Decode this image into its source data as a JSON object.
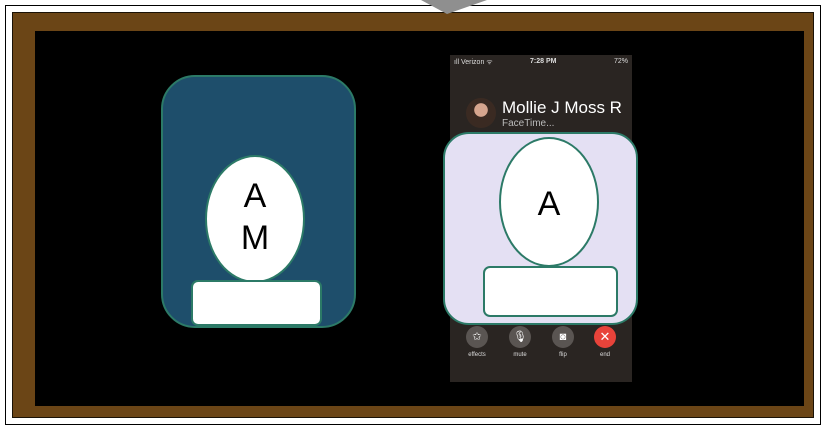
{
  "left_card": {
    "initials": [
      "A",
      "M"
    ]
  },
  "phone": {
    "status": {
      "carrier": "ıll Verizon ᯤ",
      "time": "7:28 PM",
      "battery": "72%"
    },
    "caller_name": "Mollie J Moss R",
    "caller_subtitle": "FaceTime...",
    "controls": [
      {
        "label": "effects",
        "icon": "star-icon",
        "glyph": "✩"
      },
      {
        "label": "mute",
        "icon": "mic-icon",
        "glyph": "🎙"
      },
      {
        "label": "flip",
        "icon": "camera-icon",
        "glyph": "◙"
      },
      {
        "label": "end",
        "icon": "close-icon",
        "glyph": "✕"
      }
    ]
  },
  "right_card": {
    "initial": "A"
  },
  "colors": {
    "frame": "#6b4516",
    "board": "#000000",
    "card_left": "#1e4e6b",
    "card_right": "#e4e0f3",
    "outline": "#2c7a67",
    "end_button": "#e8433a"
  }
}
